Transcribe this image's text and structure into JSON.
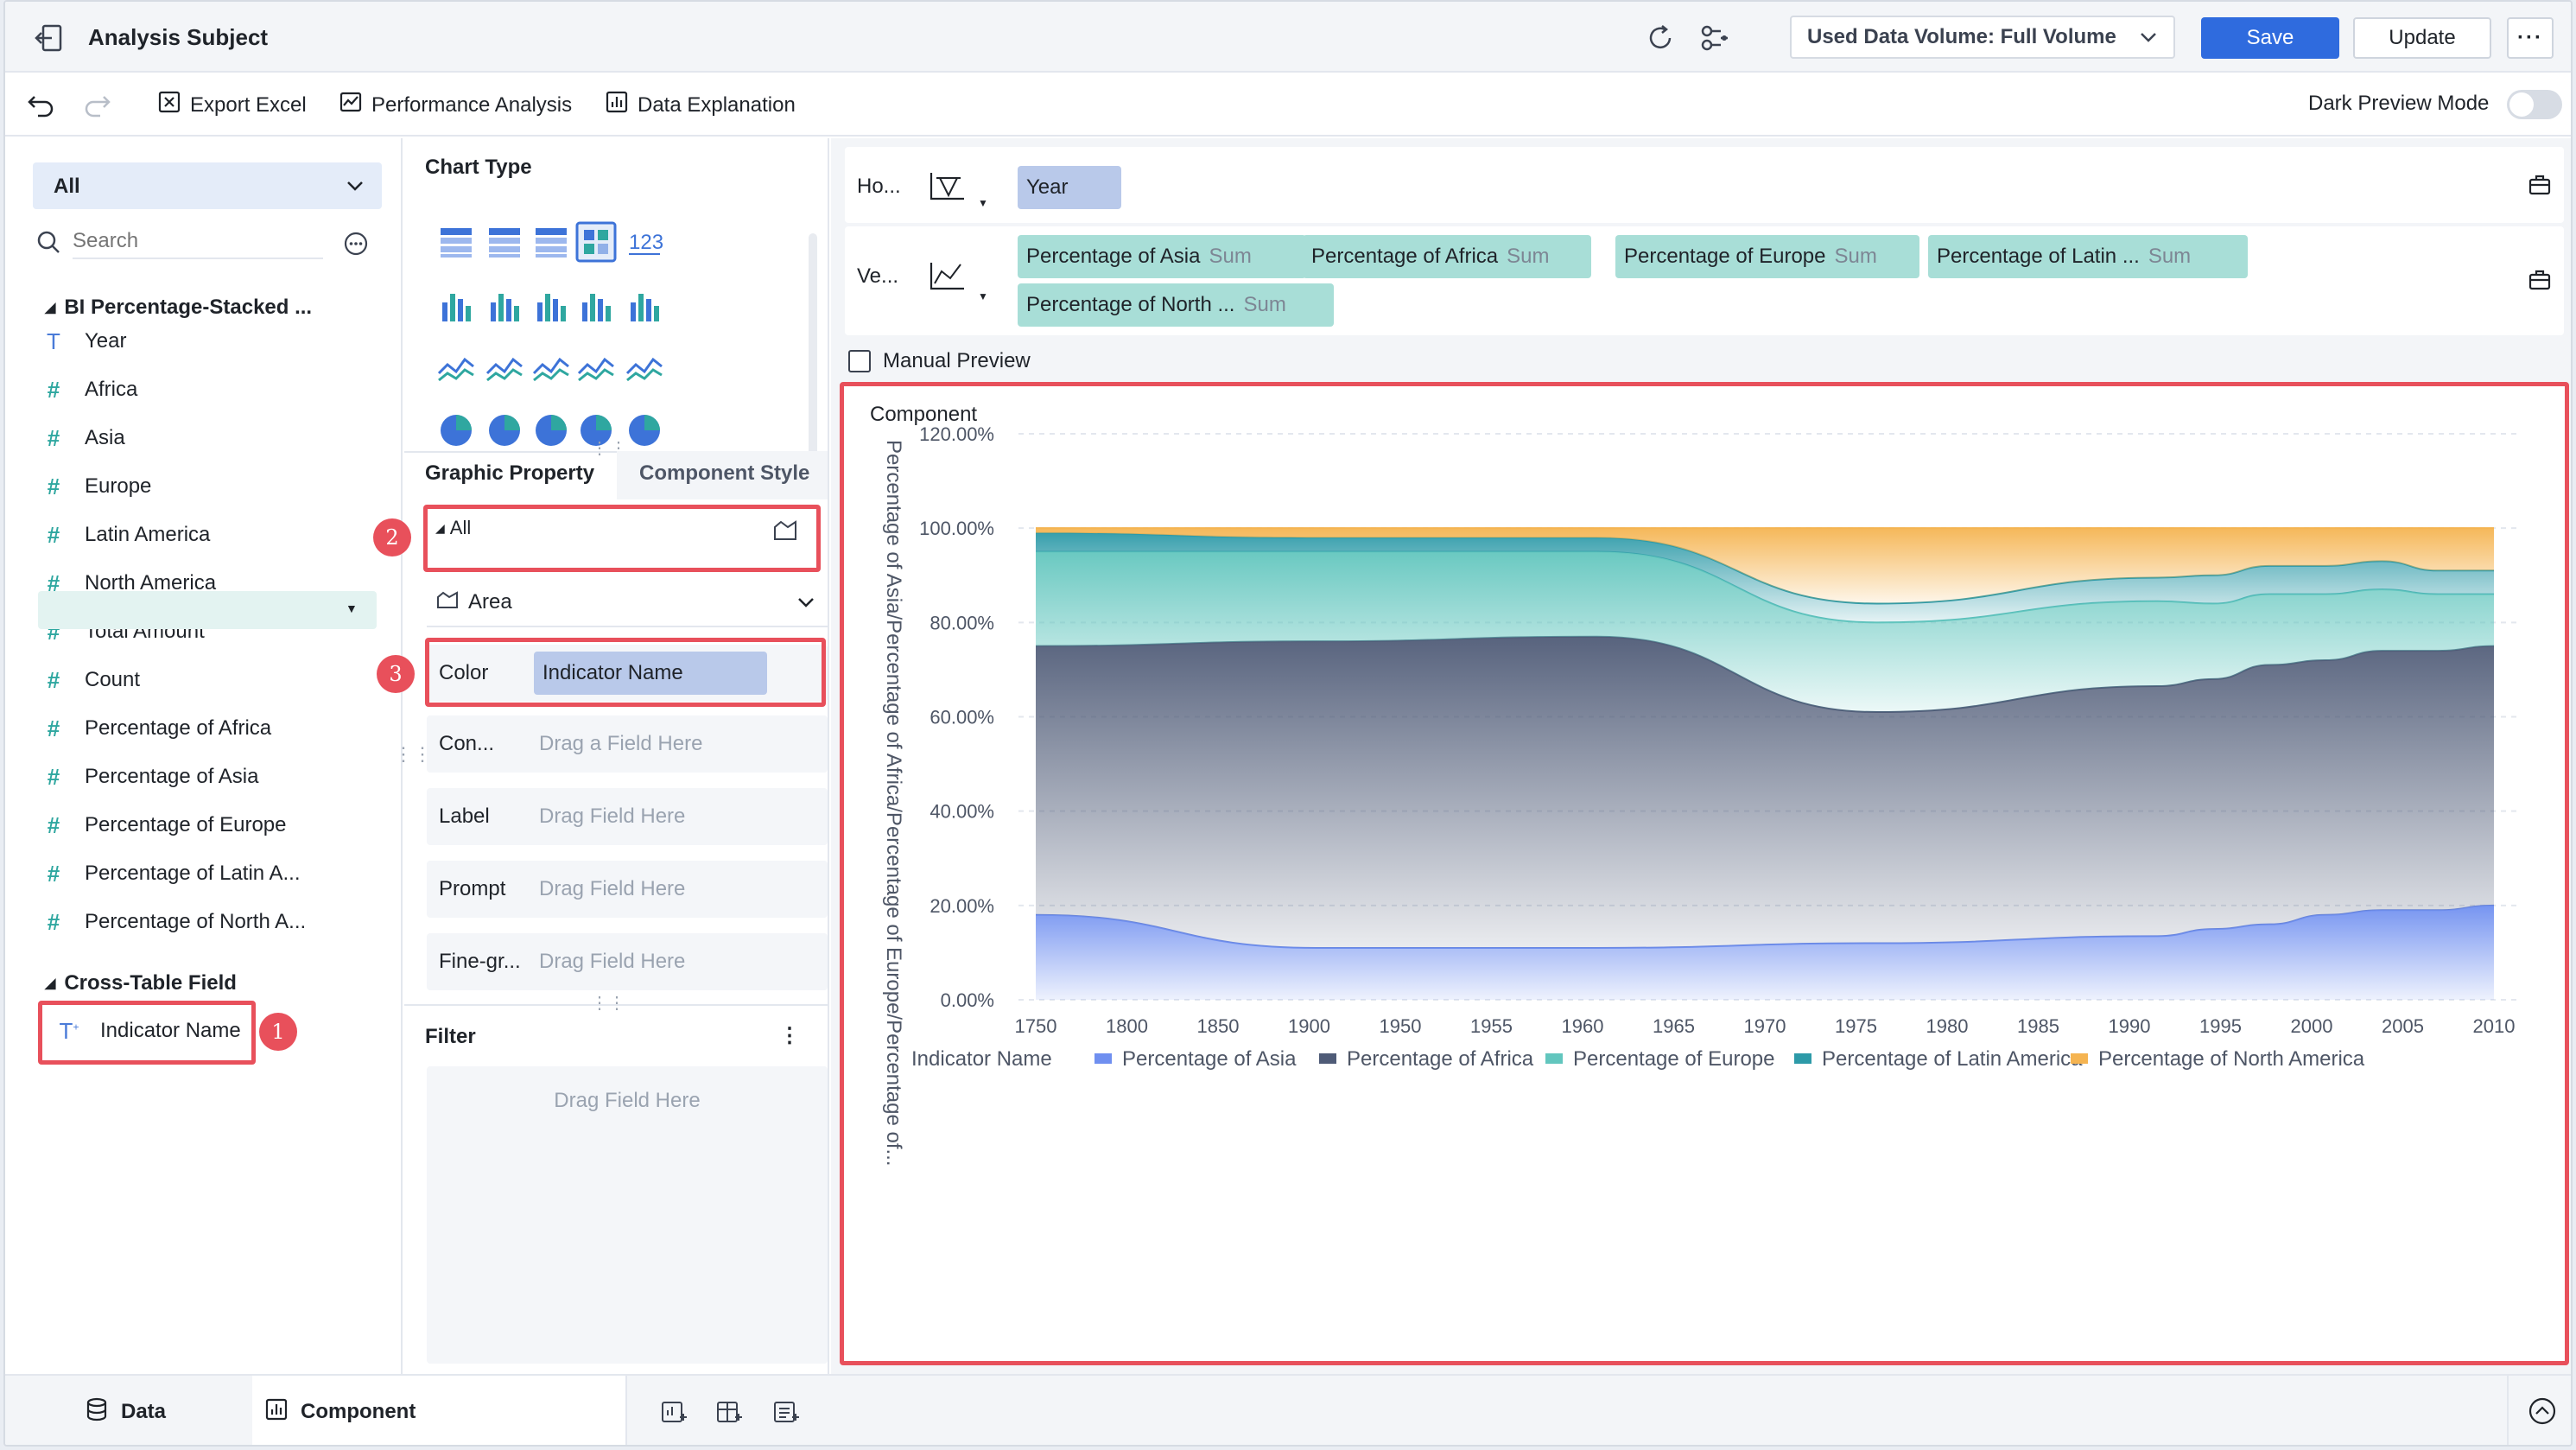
{
  "header": {
    "title": "Analysis Subject",
    "data_volume": "Used Data Volume: Full Volume",
    "save_label": "Save",
    "update_label": "Update"
  },
  "toolbar": {
    "export_excel": "Export Excel",
    "performance_analysis": "Performance Analysis",
    "data_explanation": "Data Explanation",
    "dark_preview": "Dark Preview Mode"
  },
  "fields": {
    "filter_value": "All",
    "search_placeholder": "Search",
    "dataset_name": "BI Percentage-Stacked ...",
    "items": [
      {
        "label": "Year",
        "icon": "T"
      },
      {
        "label": "Africa",
        "icon": "#"
      },
      {
        "label": "Asia",
        "icon": "#"
      },
      {
        "label": "Europe",
        "icon": "#"
      },
      {
        "label": "Latin America",
        "icon": "#"
      },
      {
        "label": "North America",
        "icon": "#"
      },
      {
        "label": "Total Amount",
        "icon": "#"
      },
      {
        "label": "Count",
        "icon": "#"
      },
      {
        "label": "Percentage of Africa",
        "icon": "#"
      },
      {
        "label": "Percentage of Asia",
        "icon": "#"
      },
      {
        "label": "Percentage of Europe",
        "icon": "#"
      },
      {
        "label": "Percentage of Latin A...",
        "icon": "#"
      },
      {
        "label": "Percentage of North A...",
        "icon": "#"
      }
    ],
    "cross_table_title": "Cross-Table Field",
    "cross_table_item": "Indicator Name"
  },
  "config": {
    "chart_type_title": "Chart Type",
    "tab_graphic": "Graphic Property",
    "tab_component": "Component Style",
    "all_label": "All",
    "area_label": "Area",
    "color_label": "Color",
    "color_value": "Indicator Name",
    "connect_label": "Con...",
    "connect_placeholder": "Drag a Field Here",
    "label_label": "Label",
    "label_placeholder": "Drag Field Here",
    "prompt_label": "Prompt",
    "prompt_placeholder": "Drag Field Here",
    "fine_label": "Fine-gr...",
    "fine_placeholder": "Drag Field Here",
    "filter_title": "Filter",
    "filter_placeholder": "Drag Field Here",
    "number_icon": "123"
  },
  "shelves": {
    "horizontal_label": "Ho...",
    "horizontal_field": "Year",
    "vertical_label": "Ve...",
    "vertical_fields": [
      {
        "name": "Percentage of Asia",
        "agg": "Sum"
      },
      {
        "name": "Percentage of Africa",
        "agg": "Sum"
      },
      {
        "name": "Percentage of Europe",
        "agg": "Sum"
      },
      {
        "name": "Percentage of Latin ...",
        "agg": "Sum"
      },
      {
        "name": "Percentage of North ...",
        "agg": "Sum"
      }
    ],
    "manual_preview": "Manual Preview"
  },
  "badges": [
    "1",
    "2",
    "3"
  ],
  "chart_data": {
    "type": "area",
    "title": "Component",
    "ylabel": "Percentage of Asia/Percentage of Africa/Percentage of Europe/Percentage of...",
    "xlabel": "",
    "ylim": [
      0,
      120
    ],
    "yticks": [
      "0.00%",
      "20.00%",
      "40.00%",
      "60.00%",
      "80.00%",
      "100.00%",
      "120.00%"
    ],
    "x": [
      1750,
      1800,
      1850,
      1900,
      1950,
      1960,
      1970,
      1980,
      1990,
      2000,
      2010
    ],
    "xticks": [
      "1750",
      "1800",
      "1850",
      "1900",
      "1950",
      "1955",
      "1960",
      "1965",
      "1970",
      "1975",
      "1980",
      "1985",
      "1990",
      "1995",
      "2000",
      "2005",
      "2010"
    ],
    "stacked_percent": true,
    "legend_title": "Indicator Name",
    "legend_position": "bottom",
    "series": [
      {
        "name": "Percentage of Asia",
        "color": "#6f8ff0",
        "values": [
          18,
          11,
          11,
          12,
          13.5,
          15,
          16,
          18,
          19,
          19,
          20
        ]
      },
      {
        "name": "Percentage of Africa",
        "color": "#4f5b77",
        "values": [
          57,
          65,
          66,
          49,
          53,
          53,
          55,
          54,
          55,
          55,
          55
        ]
      },
      {
        "name": "Percentage of Europe",
        "color": "#62c6be",
        "values": [
          20,
          19,
          18,
          19,
          18,
          16,
          15,
          14,
          13,
          12,
          11
        ]
      },
      {
        "name": "Percentage of Latin America",
        "color": "#2d9aa8",
        "values": [
          4,
          3,
          3,
          4,
          5,
          6,
          6,
          6,
          6,
          5,
          5
        ]
      },
      {
        "name": "Percentage of North America",
        "color": "#f5b451",
        "values": [
          1,
          2,
          2,
          16,
          10.5,
          10,
          8,
          8,
          7,
          9,
          9
        ]
      }
    ]
  }
}
